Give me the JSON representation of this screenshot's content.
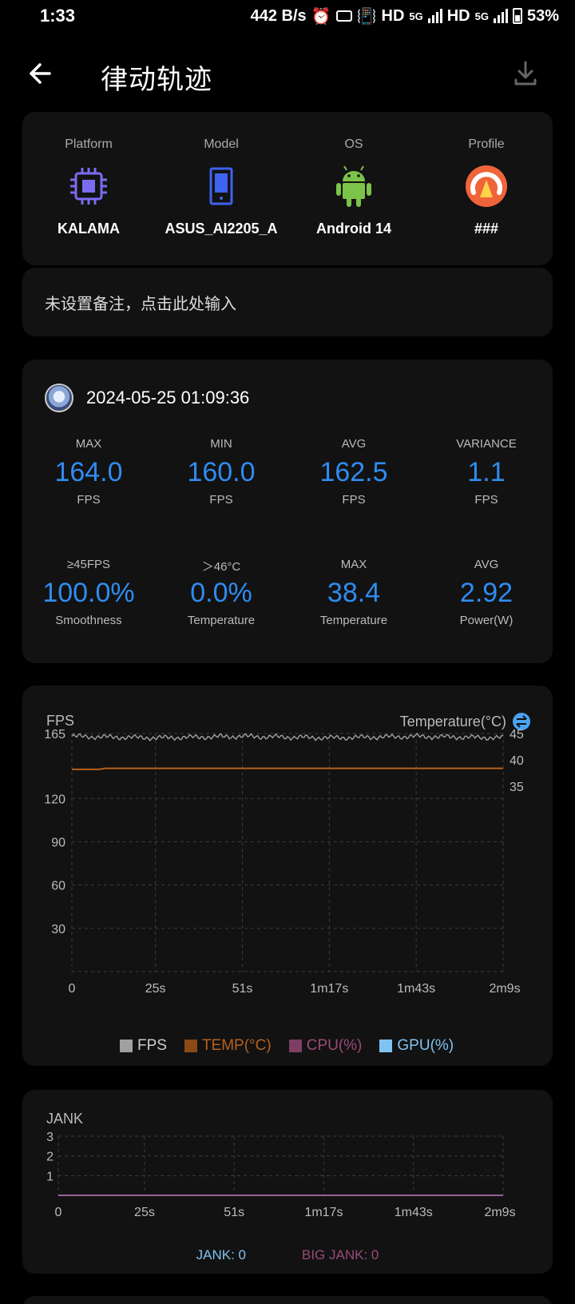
{
  "status": {
    "time": "1:33",
    "speed": "442 B/s",
    "hd1": "HD",
    "g1": "5G",
    "hd2": "HD",
    "g2": "5G",
    "battery": "53%"
  },
  "header": {
    "title": "律动轨迹"
  },
  "device": {
    "platform": {
      "label": "Platform",
      "value": "KALAMA"
    },
    "model": {
      "label": "Model",
      "value": "ASUS_AI2205_A"
    },
    "os": {
      "label": "OS",
      "value": "Android 14"
    },
    "profile": {
      "label": "Profile",
      "value": "###"
    }
  },
  "note": {
    "text": "未设置备注，点击此处输入"
  },
  "session": {
    "timestamp": "2024-05-25 01:09:36",
    "row1": [
      {
        "top": "MAX",
        "value": "164.0",
        "unit": "FPS"
      },
      {
        "top": "MIN",
        "value": "160.0",
        "unit": "FPS"
      },
      {
        "top": "AVG",
        "value": "162.5",
        "unit": "FPS"
      },
      {
        "top": "VARIANCE",
        "value": "1.1",
        "unit": "FPS"
      }
    ],
    "row2": [
      {
        "top": "≥45FPS",
        "value": "100.0%",
        "unit": "Smoothness"
      },
      {
        "top": "＞46°C",
        "value": "0.0%",
        "unit": "Temperature"
      },
      {
        "top": "MAX",
        "value": "38.4",
        "unit": "Temperature"
      },
      {
        "top": "AVG",
        "value": "2.92",
        "unit": "Power(W)"
      }
    ]
  },
  "fps_chart": {
    "title": "FPS",
    "temp_title": "Temperature(°C)",
    "legend": [
      {
        "label": "FPS",
        "color": "#a0a0a0"
      },
      {
        "label": "TEMP(°C)",
        "color": "#b8601c"
      },
      {
        "label": "CPU(%)",
        "color": "#9a4a78"
      },
      {
        "label": "GPU(%)",
        "color": "#7fc3f2"
      }
    ]
  },
  "jank_chart": {
    "title": "JANK",
    "jank_label": "JANK: 0",
    "big_jank_label": "BIG JANK: 0",
    "jank_color": "#7fc3f2",
    "big_jank_color": "#9a4a78"
  },
  "chart_data": [
    {
      "type": "line",
      "x_ticks": [
        "0",
        "25s",
        "51s",
        "1m17s",
        "1m43s",
        "2m9s"
      ],
      "x_seconds": [
        0,
        25,
        51,
        77,
        103,
        129
      ],
      "y_left_ticks": [
        "165",
        "120",
        "90",
        "60",
        "30"
      ],
      "y_left_values": [
        165,
        120,
        90,
        60,
        30
      ],
      "y_right_ticks": [
        "45",
        "40",
        "35"
      ],
      "y_right_values": [
        45,
        40,
        35
      ],
      "ylim": [
        0,
        165
      ],
      "y2lim": [
        35,
        45
      ],
      "series": [
        {
          "name": "FPS",
          "axis": "left",
          "x": [
            0,
            25,
            51,
            77,
            103,
            129
          ],
          "values": [
            163,
            162,
            163,
            162,
            163,
            162
          ]
        },
        {
          "name": "TEMP(°C)",
          "axis": "right",
          "x": [
            0,
            8,
            10,
            129
          ],
          "values": [
            38.2,
            38.2,
            38.4,
            38.4
          ]
        }
      ],
      "grid": true
    },
    {
      "type": "line",
      "x_ticks": [
        "0",
        "25s",
        "51s",
        "1m17s",
        "1m43s",
        "2m9s"
      ],
      "x_seconds": [
        0,
        25,
        51,
        77,
        103,
        129
      ],
      "y_ticks": [
        "3",
        "2",
        "1"
      ],
      "y_values": [
        3,
        2,
        1
      ],
      "ylim": [
        0,
        3
      ],
      "series": [
        {
          "name": "JANK",
          "x": [
            0,
            129
          ],
          "values": [
            0,
            0
          ]
        },
        {
          "name": "BIG JANK",
          "x": [
            0,
            129
          ],
          "values": [
            0,
            0
          ]
        }
      ],
      "grid": true
    }
  ]
}
